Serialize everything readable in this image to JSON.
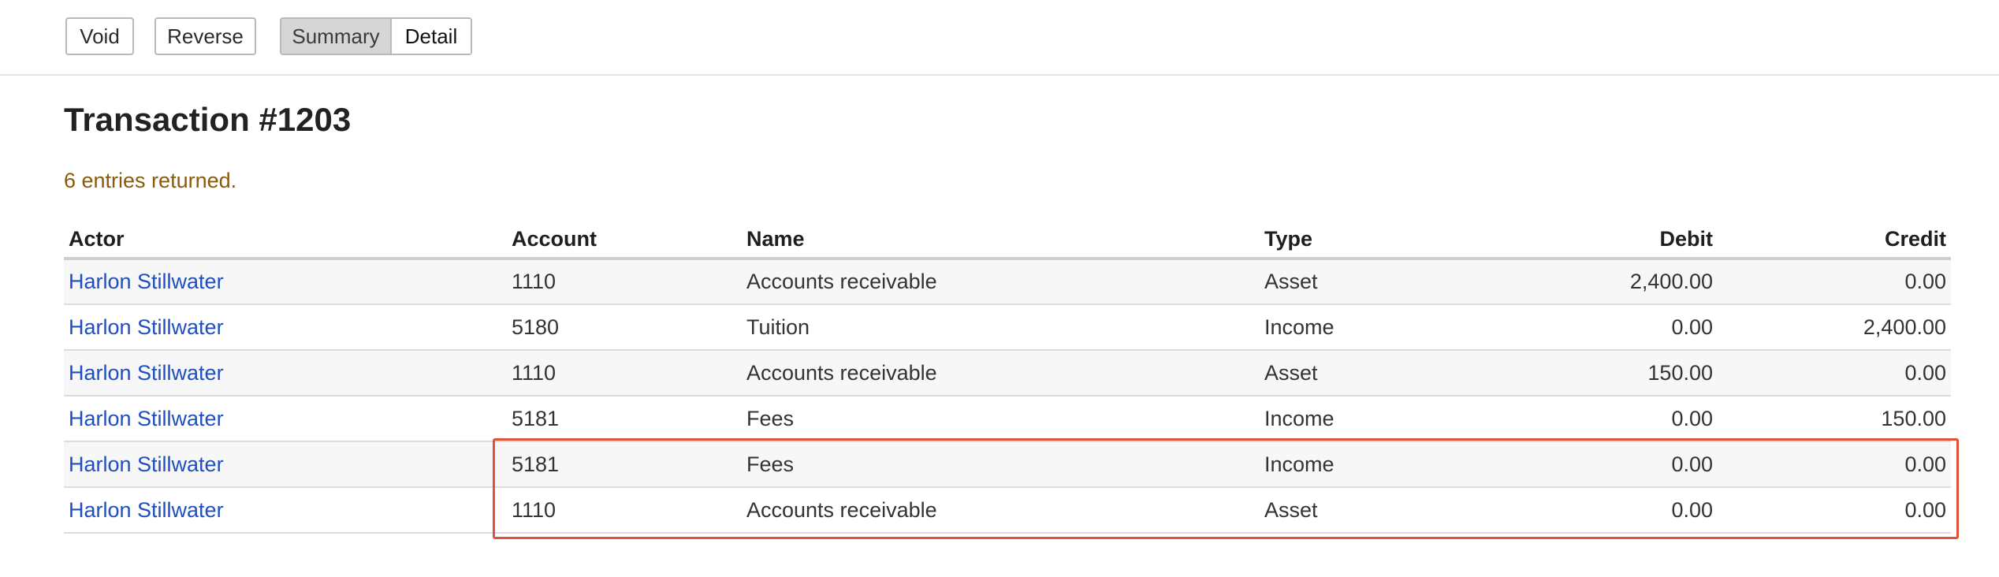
{
  "toolbar": {
    "void_label": "Void",
    "reverse_label": "Reverse",
    "view_toggle": {
      "summary_label": "Summary",
      "detail_label": "Detail",
      "selected": "Detail"
    }
  },
  "page": {
    "title": "Transaction #1203",
    "status_message": "6 entries returned."
  },
  "table": {
    "columns": {
      "actor": "Actor",
      "account": "Account",
      "name": "Name",
      "type": "Type",
      "debit": "Debit",
      "credit": "Credit"
    },
    "rows": [
      {
        "actor": "Harlon Stillwater",
        "account": "1110",
        "name": "Accounts receivable",
        "type": "Asset",
        "debit": "2,400.00",
        "credit": "0.00"
      },
      {
        "actor": "Harlon Stillwater",
        "account": "5180",
        "name": "Tuition",
        "type": "Income",
        "debit": "0.00",
        "credit": "2,400.00"
      },
      {
        "actor": "Harlon Stillwater",
        "account": "1110",
        "name": "Accounts receivable",
        "type": "Asset",
        "debit": "150.00",
        "credit": "0.00"
      },
      {
        "actor": "Harlon Stillwater",
        "account": "5181",
        "name": "Fees",
        "type": "Income",
        "debit": "0.00",
        "credit": "150.00"
      },
      {
        "actor": "Harlon Stillwater",
        "account": "5181",
        "name": "Fees",
        "type": "Income",
        "debit": "0.00",
        "credit": "0.00"
      },
      {
        "actor": "Harlon Stillwater",
        "account": "1110",
        "name": "Accounts receivable",
        "type": "Asset",
        "debit": "0.00",
        "credit": "0.00"
      }
    ]
  },
  "colors": {
    "link": "#1f4fbf",
    "status_text": "#8a5a0b",
    "highlight_border": "#e0533a",
    "segment_selected_bg": "#d6d6d6"
  }
}
